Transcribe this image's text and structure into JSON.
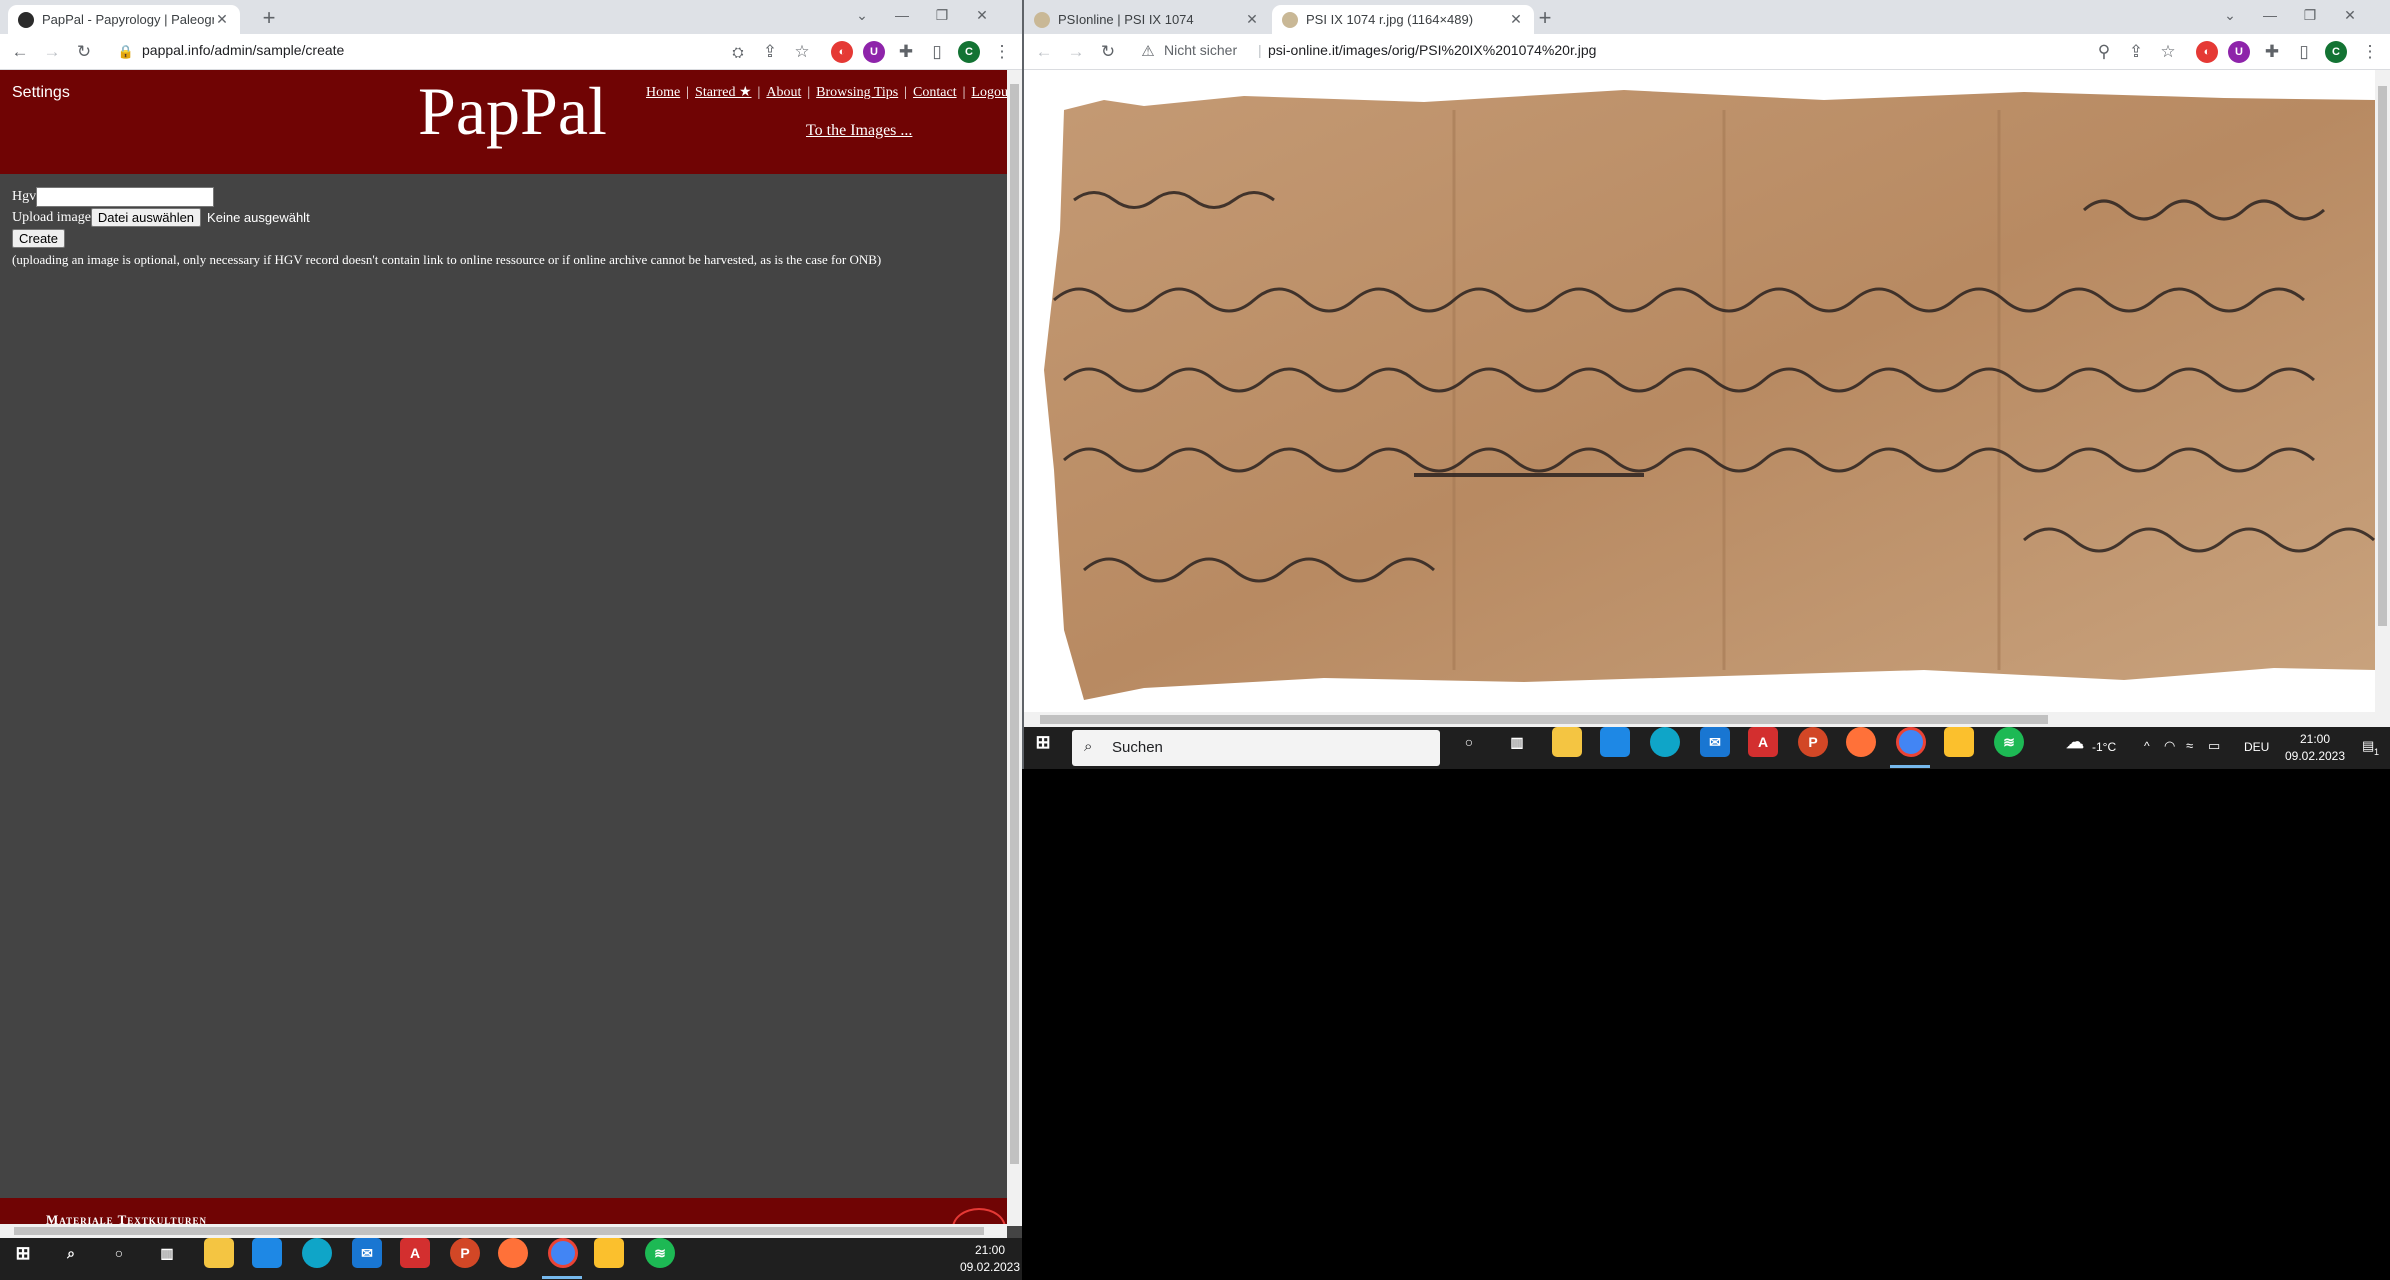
{
  "left": {
    "tab_title": "PapPal - Papyrology | Paleography",
    "url": "pappal.info/admin/sample/create",
    "header": {
      "settings": "Settings",
      "logo": "PapPal",
      "nav": [
        "Home",
        "Starred ★",
        "About",
        "Browsing Tips",
        "Contact",
        "Logout"
      ],
      "to_images": "To the Images ..."
    },
    "form": {
      "hgv_label": "Hgv",
      "upload_label": "Upload image",
      "file_button": "Datei auswählen",
      "file_status": "Keine ausgewählt",
      "create_button": "Create",
      "note": "(uploading an image is optional, only necessary if HGV record doesn't contain link to online ressource or if online archive cannot be harvested, as is the case for ONB)"
    },
    "footer": "Materiale Textkulturen",
    "taskbar": {
      "time": "21:00",
      "date": "09.02.2023"
    },
    "profile_initial": "C"
  },
  "right": {
    "tabs": [
      "PSIonline | PSI IX 1074",
      "PSI IX 1074 r.jpg (1164×489)"
    ],
    "not_secure": "Nicht sicher",
    "url": "psi-online.it/images/orig/PSI%20IX%201074%20r.jpg",
    "taskbar": {
      "search": "Suchen",
      "weather": "-1°C",
      "lang": "DEU",
      "time": "21:00",
      "date": "09.02.2023",
      "notif": "1"
    },
    "profile_initial": "C"
  },
  "colors": {
    "header_red": "#700404",
    "page_bg": "#444444",
    "tabstrip": "#dee1e6",
    "papyrus": "#c49a74"
  },
  "icons": [
    "back-icon",
    "forward-icon",
    "reload-icon",
    "lock-icon",
    "translate-icon",
    "share-icon",
    "star-icon",
    "puzzle-icon",
    "sidepanel-icon",
    "menu-icon",
    "windows-icon",
    "search-icon",
    "cortana-icon",
    "taskview-icon"
  ]
}
